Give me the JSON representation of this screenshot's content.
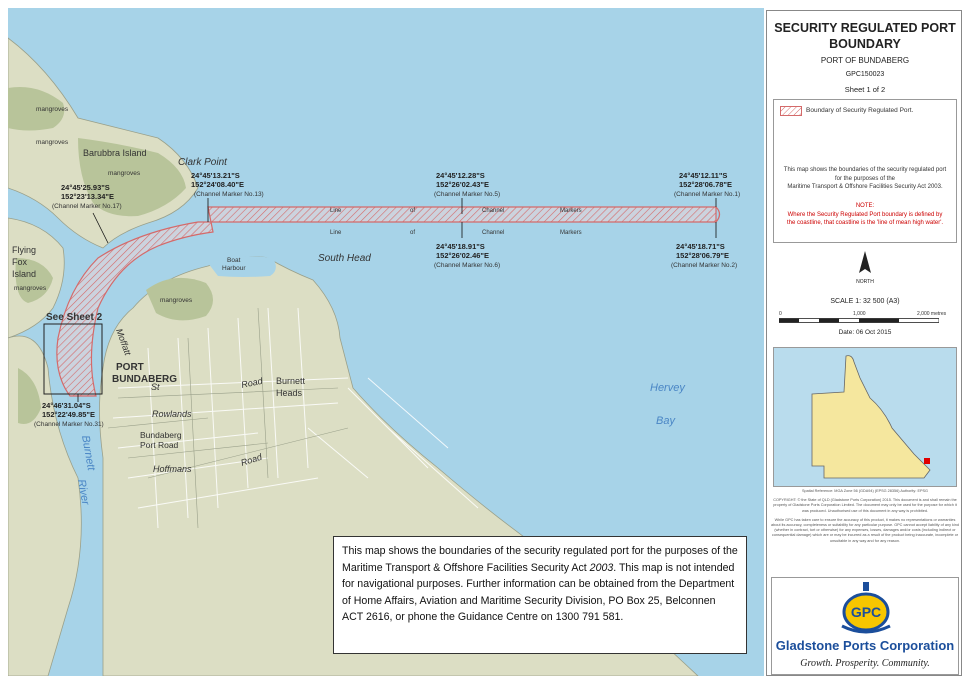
{
  "map": {
    "labels": {
      "mangroves": "mangroves",
      "barubbra_island": "Barubbra Island",
      "clark_point": "Clark Point",
      "flying": "Flying",
      "fox": "Fox",
      "island": "Island",
      "south_head": "South Head",
      "boat": "Boat",
      "harbour": "Harbour",
      "see_sheet": "See Sheet 2",
      "port": "PORT",
      "bundaberg": "BUNDABERG",
      "moffatt": "Moffatt",
      "st": "St",
      "road": "Road",
      "burnett": "Burnett",
      "heads": "Heads",
      "rowlands": "Rowlands",
      "bundaberg_port_road_1": "Bundaberg",
      "bundaberg_port_road_2": "Port Road",
      "hoffmans": "Hoffmans",
      "hervey": "Hervey",
      "bay": "Bay",
      "burnett_river_1": "Burnett",
      "burnett_river_2": "River",
      "line": "Line",
      "of": "of",
      "channel": "Channel",
      "markers": "Markers"
    },
    "coordinates": [
      {
        "lat": "24°45'25.93\"S",
        "lon": "152°23'13.34\"E",
        "marker": "(Channel Marker No.17)"
      },
      {
        "lat": "24°45'13.21\"S",
        "lon": "152°24'08.40\"E",
        "marker": "(Channel Marker No.13)"
      },
      {
        "lat": "24°45'12.28\"S",
        "lon": "152°26'02.43\"E",
        "marker": "(Channel Marker No.5)"
      },
      {
        "lat": "24°45'12.11\"S",
        "lon": "152°28'06.78\"E",
        "marker": "(Channel Marker No.1)"
      },
      {
        "lat": "24°45'18.91\"S",
        "lon": "152°26'02.46\"E",
        "marker": "(Channel Marker No.6)"
      },
      {
        "lat": "24°45'18.71\"S",
        "lon": "152°28'06.79\"E",
        "marker": "(Channel Marker No.2)"
      },
      {
        "lat": "24°46'31.04\"S",
        "lon": "152°22'49.85\"E",
        "marker": "(Channel Marker No.31)"
      }
    ]
  },
  "note": {
    "text_before": "This map shows the boundaries of the security regulated port for the purposes of the Maritime Transport & Offshore Facilities Security Act ",
    "year": "2003",
    "text_after": ". This map is not intended for navigational purposes.  Further information can be obtained from the Department of Home Affairs, Aviation and Maritime Security Division, PO Box 25, Belconnen ACT 2616, or phone the Guidance Centre on 1300 791 581."
  },
  "panel": {
    "title_line1": "SECURITY REGULATED PORT",
    "title_line2": "BOUNDARY",
    "port_name": "PORT OF BUNDABERG",
    "map_id": "GPC150023",
    "sheet": "Sheet 1 of 2",
    "legend_label": "Boundary of Security Regulated Port.",
    "description_1": "This map shows the boundaries of the security regulated port",
    "description_2": "for the purposes of the",
    "description_3": "Maritime Transport & Offshore Facilities Security Act 2003.",
    "note_heading": "NOTE:",
    "note_1": "Where the Security Regulated Port boundary is defined by",
    "note_2": "the coastline, that coastline is the 'line of mean high water'.",
    "north_label": "NORTH",
    "scale": "SCALE 1: 32 500 (A3)",
    "scale_ticks": [
      "0",
      "1,000",
      "2,000 metres"
    ],
    "date": "Date: 06 Oct 2015",
    "spatial_reference": "Spatial Reference: MGA Zone 56 (GDA94) (EPSG 28356) Authority: EPSG",
    "copyright": "COPYRIGHT: © the State of QLD (Gladstone Ports Corporation) 2015. This document is and shall remain the property of Gladstone Ports Corporation Limited. The document may only be used for the purpose for which it was produced. Unauthorised use of this document in any way is prohibited.",
    "disclaimer": "While GPC has taken care to ensure the accuracy of this product, it makes no representations or warranties about its accuracy, completeness or suitability for any particular purpose. GPC cannot accept liability of any kind (whether in contract, tort or otherwise) for any expenses, losses, damages and/or costs (including indirect or consequential damage) which are or may be incurred as a result of the product being inaccurate, incomplete or unsuitable in any way and for any reason.",
    "logo_gpc": "GPC",
    "logo_name": "Gladstone Ports Corporation",
    "logo_tagline": "Growth. Prosperity. Community."
  },
  "colors": {
    "water": "#a7d3e8",
    "land": "#dcdec4",
    "mangroves": "#b8c49a",
    "boundary": "#e06a6a",
    "note_red": "#cc0000",
    "inset_land": "#f5e79e",
    "logo_blue": "#1b4e9b",
    "logo_yellow": "#f7c600"
  }
}
